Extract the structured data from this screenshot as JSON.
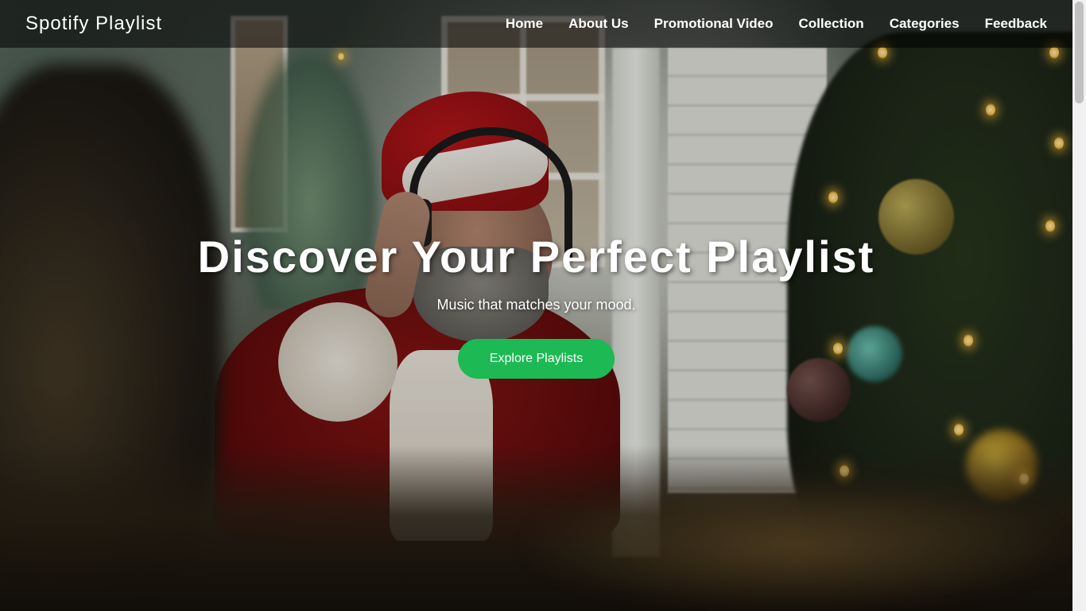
{
  "navbar": {
    "brand": "Spotify Playlist",
    "links": [
      {
        "label": "Home"
      },
      {
        "label": "About Us"
      },
      {
        "label": "Promotional Video"
      },
      {
        "label": "Collection"
      },
      {
        "label": "Categories"
      },
      {
        "label": "Feedback"
      }
    ]
  },
  "hero": {
    "title": "Discover Your Perfect Playlist",
    "subtitle": "Music that matches your mood.",
    "cta_label": "Explore Playlists",
    "background_image": "santa-with-headphones-christmas-scene"
  },
  "colors": {
    "accent": "#1db954",
    "navbar_bg": "rgba(0,0,0,0.55)",
    "text": "#ffffff"
  }
}
